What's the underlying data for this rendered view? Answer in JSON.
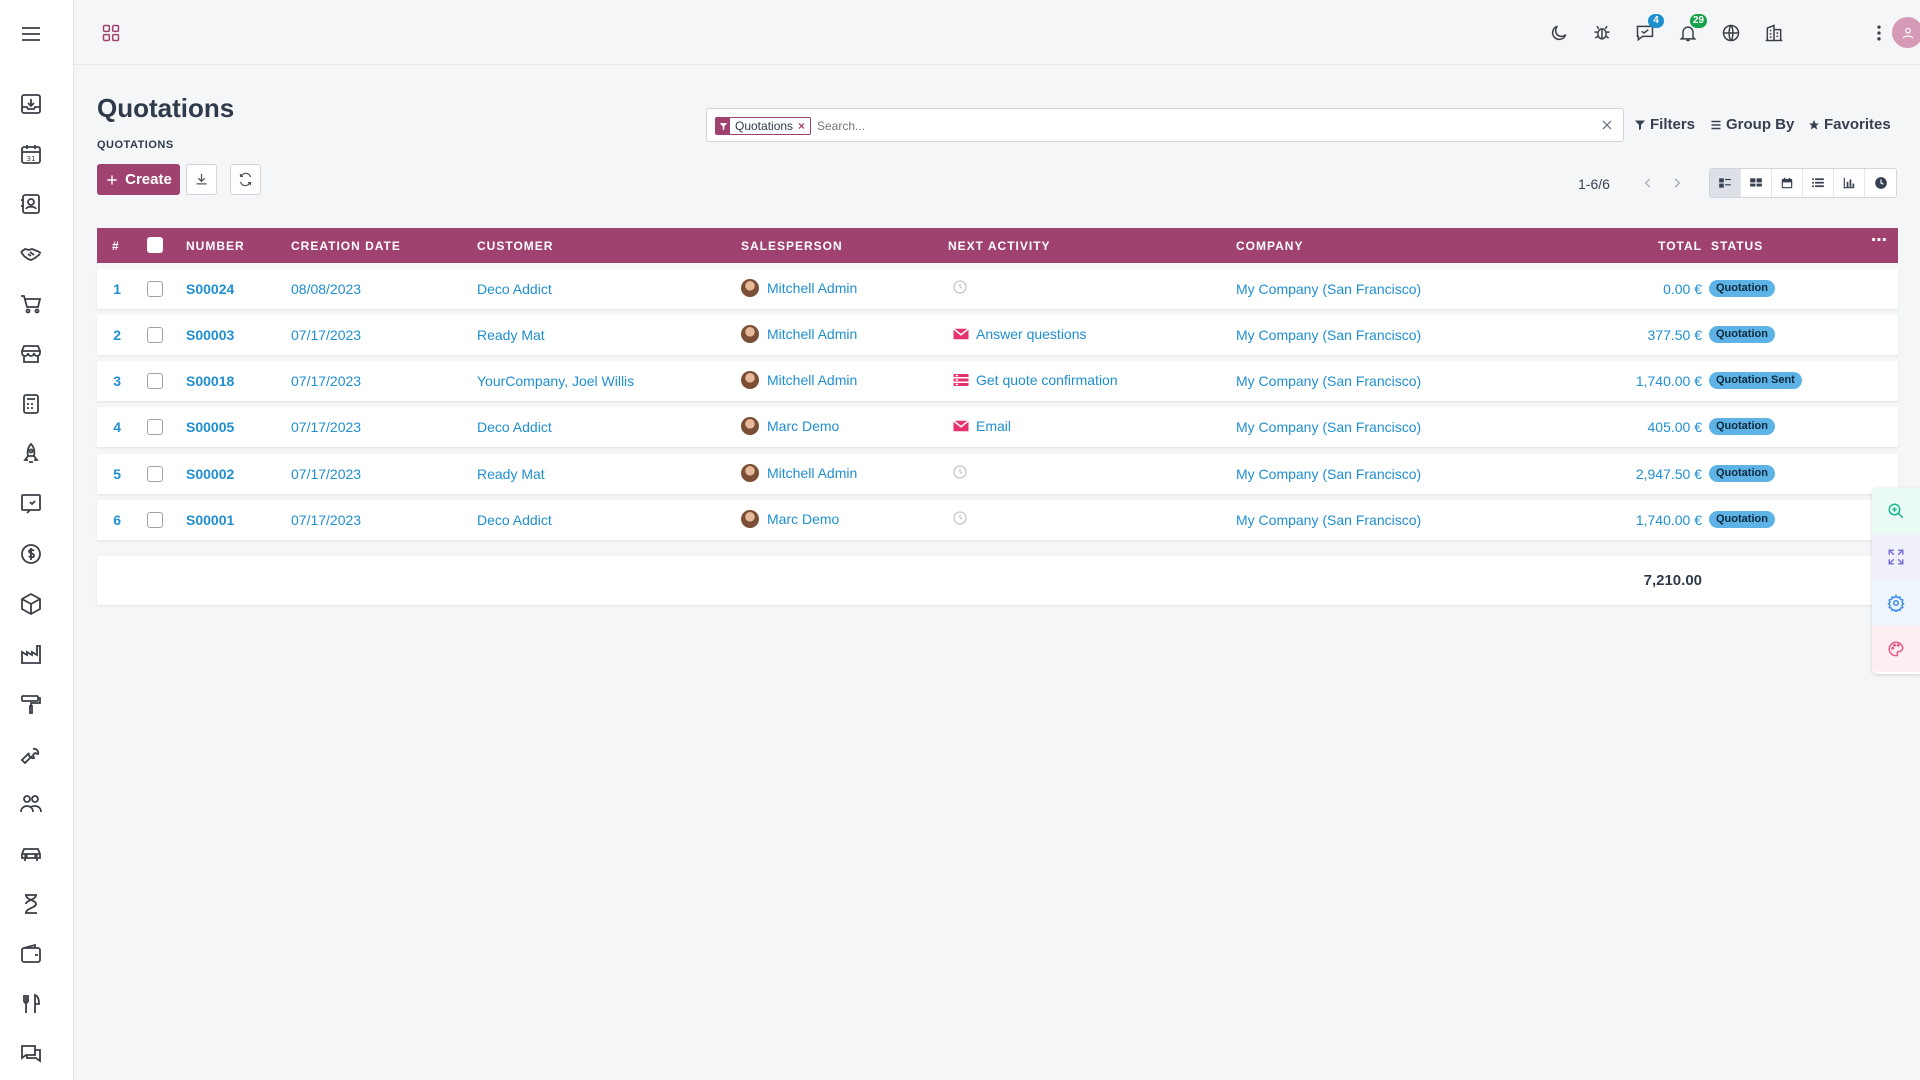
{
  "sidebar": {
    "icons": [
      "download-tray-icon",
      "calendar-icon",
      "contacts-icon",
      "handshake-icon",
      "cart-icon",
      "store-icon",
      "calculator-icon",
      "rocket-icon",
      "chat-board-icon",
      "dollar-icon",
      "cube-icon",
      "factory-icon",
      "paint-roller-icon",
      "wrench-icon",
      "team-icon",
      "car-icon",
      "hourglass-icon",
      "wallet-icon",
      "utensils-icon",
      "discuss-icon"
    ]
  },
  "topbar": {
    "messages_count": "4",
    "notifications_count": "29",
    "badge_blue": "#1f8fd0",
    "badge_green": "#16a34a"
  },
  "page": {
    "title": "Quotations",
    "breadcrumb": "QUOTATIONS",
    "create_label": "Create"
  },
  "search": {
    "facet": "Quotations",
    "placeholder": "Search...",
    "filters_label": "Filters",
    "groupby_label": "Group By",
    "favorites_label": "Favorites"
  },
  "pager": {
    "value": "1-6/6"
  },
  "table": {
    "headers": {
      "idx": "#",
      "number": "NUMBER",
      "date": "CREATION DATE",
      "customer": "CUSTOMER",
      "salesperson": "SALESPERSON",
      "activity": "NEXT ACTIVITY",
      "company": "COMPANY",
      "total": "TOTAL",
      "status": "STATUS"
    },
    "rows": [
      {
        "idx": "1",
        "number": "S00024",
        "date": "08/08/2023",
        "customer": "Deco Addict",
        "salesperson": "Mitchell Admin",
        "activity": "",
        "activity_icon": "clock-icon",
        "company": "My Company (San Francisco)",
        "total": "0.00 €",
        "status": "Quotation"
      },
      {
        "idx": "2",
        "number": "S00003",
        "date": "07/17/2023",
        "customer": "Ready Mat",
        "salesperson": "Mitchell Admin",
        "activity": "Answer questions",
        "activity_icon": "envelope-icon",
        "company": "My Company (San Francisco)",
        "total": "377.50 €",
        "status": "Quotation"
      },
      {
        "idx": "3",
        "number": "S00018",
        "date": "07/17/2023",
        "customer": "YourCompany, Joel Willis",
        "salesperson": "Mitchell Admin",
        "activity": "Get quote confirmation",
        "activity_icon": "list-icon",
        "company": "My Company (San Francisco)",
        "total": "1,740.00 €",
        "status": "Quotation Sent"
      },
      {
        "idx": "4",
        "number": "S00005",
        "date": "07/17/2023",
        "customer": "Deco Addict",
        "salesperson": "Marc Demo",
        "activity": "Email",
        "activity_icon": "envelope-icon",
        "company": "My Company (San Francisco)",
        "total": "405.00 €",
        "status": "Quotation"
      },
      {
        "idx": "5",
        "number": "S00002",
        "date": "07/17/2023",
        "customer": "Ready Mat",
        "salesperson": "Mitchell Admin",
        "activity": "",
        "activity_icon": "clock-icon",
        "company": "My Company (San Francisco)",
        "total": "2,947.50 €",
        "status": "Quotation"
      },
      {
        "idx": "6",
        "number": "S00001",
        "date": "07/17/2023",
        "customer": "Deco Addict",
        "salesperson": "Marc Demo",
        "activity": "",
        "activity_icon": "clock-icon",
        "company": "My Company (San Francisco)",
        "total": "1,740.00 €",
        "status": "Quotation"
      }
    ],
    "grand_total": "7,210.00"
  },
  "colors": {
    "accent": "#a0426f",
    "link": "#1f8fd0",
    "status_badge": "#5db3e6",
    "activity_icon": "#e6336e"
  }
}
